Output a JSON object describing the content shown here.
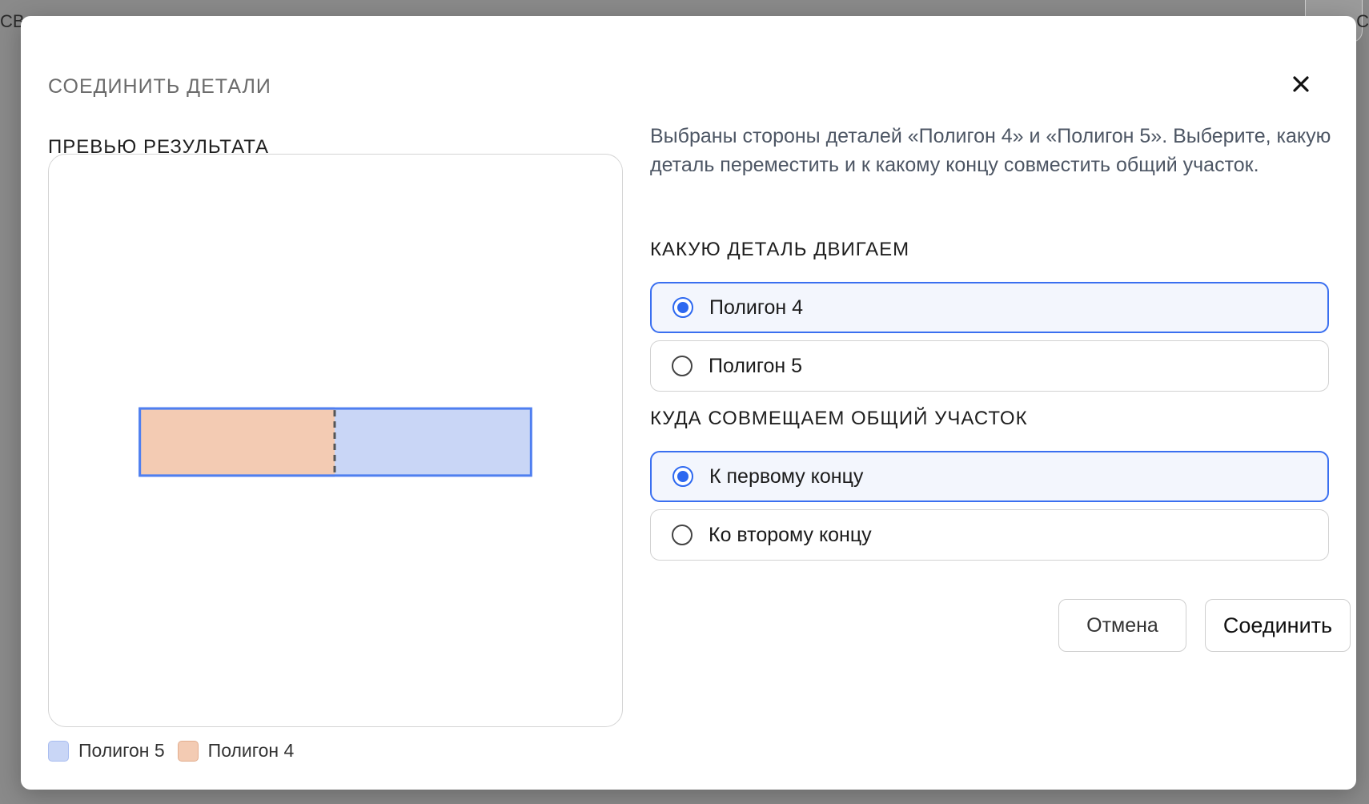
{
  "background": {
    "left_fragment": "СВ",
    "right_fragment": "С"
  },
  "dialog": {
    "title": "СОЕДИНИТЬ ДЕТАЛИ",
    "close_icon": "close-icon",
    "preview": {
      "label": "ПРЕВЬЮ РЕЗУЛЬТАТА",
      "legend": [
        {
          "label": "Полигон 5",
          "color": "#c9d6f6"
        },
        {
          "label": "Полигон 4",
          "color": "#f3cbb3"
        }
      ]
    },
    "description": "Выбраны стороны деталей «Полигон 4» и «Полигон 5». Выберите, какую деталь переместить и к какому концу совместить общий участок.",
    "move_section": {
      "label": "КАКУЮ ДЕТАЛЬ ДВИГАЕМ",
      "options": [
        {
          "label": "Полигон 4",
          "selected": true
        },
        {
          "label": "Полигон 5",
          "selected": false
        }
      ]
    },
    "align_section": {
      "label": "КУДА СОВМЕЩАЕМ ОБЩИЙ УЧАСТОК",
      "options": [
        {
          "label": "К первому концу",
          "selected": true
        },
        {
          "label": "Ко второму концу",
          "selected": false
        }
      ]
    },
    "buttons": {
      "cancel": "Отмена",
      "join": "Соединить"
    }
  },
  "colors": {
    "accent": "#2d68f0",
    "polygon5_fill": "#c9d6f6",
    "polygon5_stroke": "#4f7ff0",
    "polygon4_fill": "#f3cbb3",
    "divider": "#555555"
  }
}
